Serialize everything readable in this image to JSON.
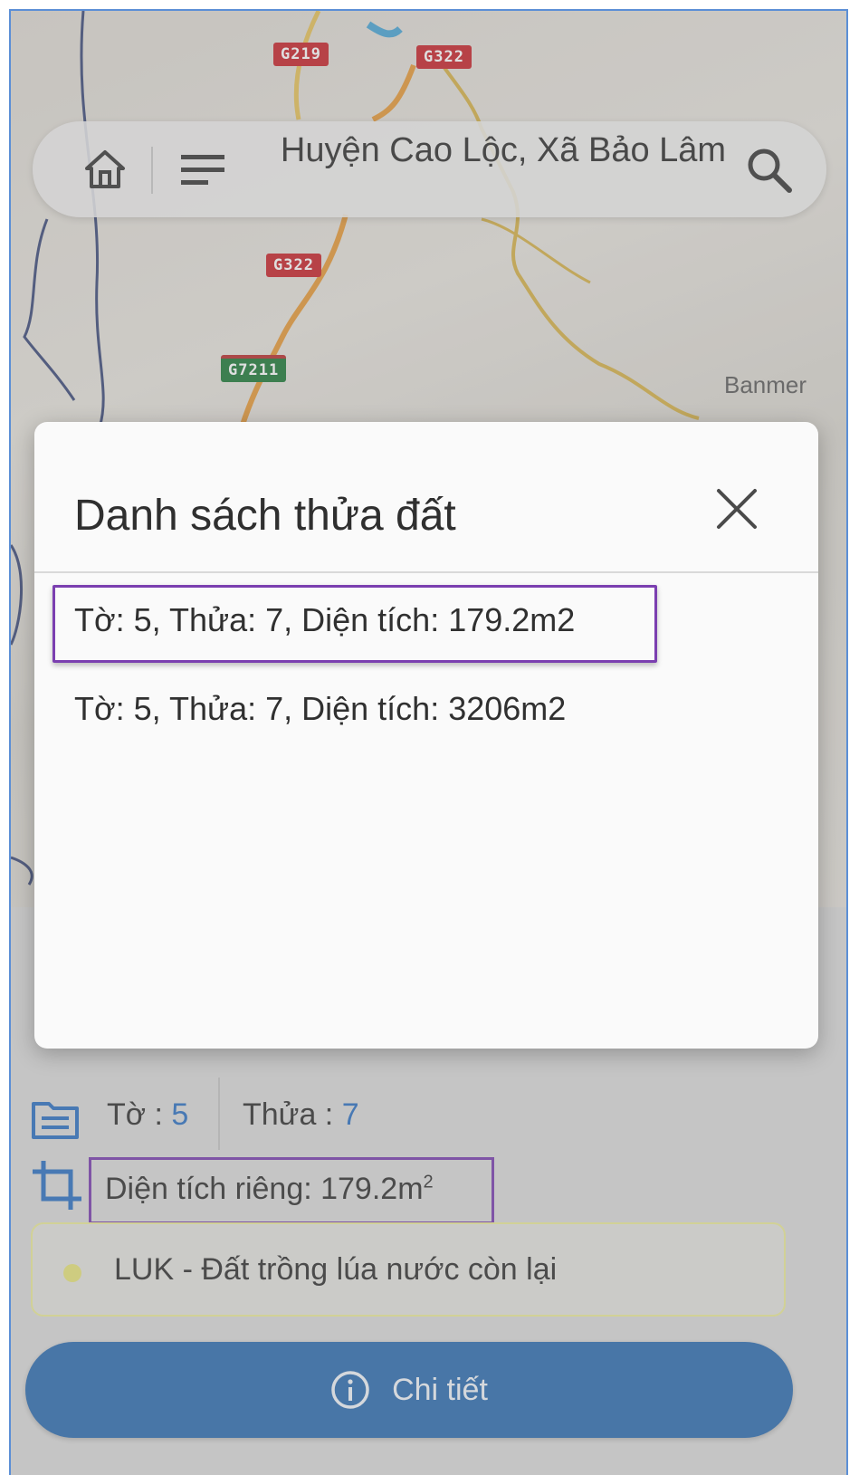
{
  "map": {
    "road_shields": [
      {
        "text": "G219",
        "kind": "red"
      },
      {
        "text": "G322",
        "kind": "red"
      },
      {
        "text": "G322",
        "kind": "red"
      },
      {
        "text": "G7211",
        "kind": "green"
      }
    ],
    "place_label": "Banmer"
  },
  "search_bar": {
    "title": "Huyện Cao Lộc, Xã Bảo Lâm",
    "home_icon": "home-icon",
    "menu_icon": "menu-icon",
    "search_icon": "search-icon"
  },
  "dialog": {
    "title": "Danh sách thửa đất",
    "close_icon": "close-icon",
    "items": [
      {
        "label": "Tờ: 5, Thửa: 7, Diện tích: 179.2m2",
        "highlighted": true
      },
      {
        "label": "Tờ: 5, Thửa: 7, Diện tích: 3206m2",
        "highlighted": false
      }
    ]
  },
  "parcel_info": {
    "to_label": "Tờ : ",
    "to_value": "5",
    "thua_label": "Thửa : ",
    "thua_value": "7",
    "area_label": "Diện tích riêng: 179.2m",
    "area_sup": "2",
    "land_use": "LUK - Đất trồng lúa nước còn lại",
    "land_dot_color": "#e8e57c"
  },
  "detail_button": {
    "label": "Chi tiết",
    "icon": "info-icon"
  },
  "colors": {
    "accent_blue": "#2f6eb2",
    "value_blue": "#2f72c4",
    "highlight_purple": "#7b3fb0",
    "shield_red": "#c8262d",
    "shield_green": "#1f7a3a"
  }
}
